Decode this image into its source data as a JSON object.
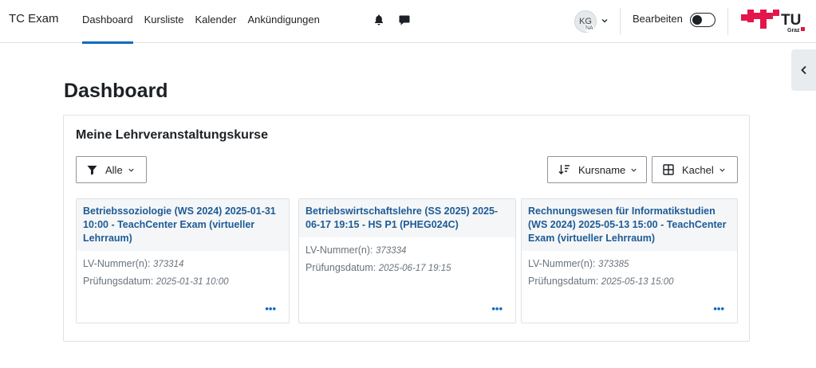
{
  "app": {
    "title": "TC Exam"
  },
  "nav": {
    "items": [
      {
        "label": "Dashboard",
        "active": true
      },
      {
        "label": "Kursliste",
        "active": false
      },
      {
        "label": "Kalender",
        "active": false
      },
      {
        "label": "Ankündigungen",
        "active": false
      }
    ],
    "icons": [
      "bell-icon",
      "chat-icon"
    ]
  },
  "user": {
    "initials": "KG",
    "sub": "NA"
  },
  "edit_mode": {
    "label": "Bearbeiten",
    "on": false
  },
  "logo": {
    "text": "TU",
    "sub": "Graz"
  },
  "page": {
    "title": "Dashboard"
  },
  "courses_block": {
    "title": "Meine Lehrveranstaltungskurse",
    "filter_label": "Alle",
    "sort_label": "Kursname",
    "view_label": "Kachel",
    "field_lv": "LV-Nummer(n):",
    "field_date": "Prüfungsdatum:",
    "more": "•••",
    "courses": [
      {
        "title": "Betriebssoziologie (WS 2024) 2025-01-31 10:00 - TeachCenter Exam (virtueller Lehrraum)",
        "lv": "373314",
        "date": "2025-01-31 10:00"
      },
      {
        "title": "Betriebswirtschaftslehre (SS 2025) 2025-06-17 19:15 - HS P1 (PHEG024C)",
        "lv": "373334",
        "date": "2025-06-17 19:15"
      },
      {
        "title": "Rechnungswesen für Informatikstudien (WS 2024) 2025-05-13 15:00 - TeachCenter Exam (virtueller Lehrraum)",
        "lv": "373385",
        "date": "2025-05-13 15:00"
      }
    ]
  },
  "colors": {
    "accent": "#0f6cbf",
    "link": "#1d5b96",
    "logo_red": "#e4154b"
  }
}
